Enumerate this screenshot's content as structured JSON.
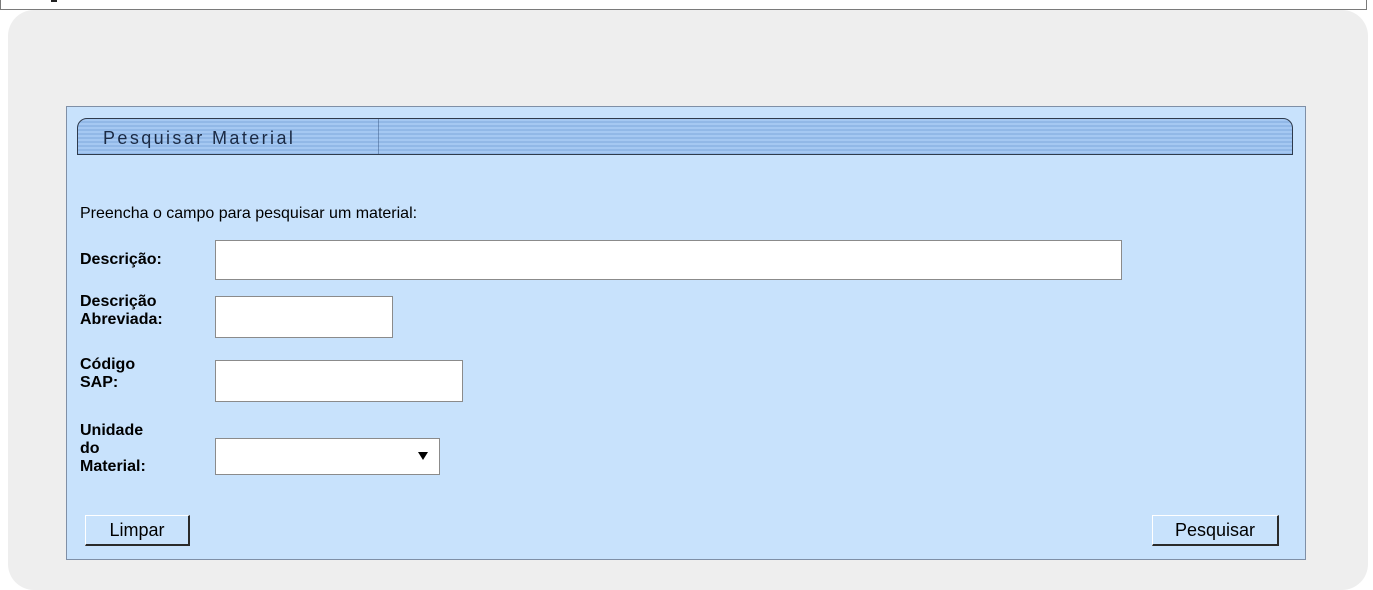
{
  "form": {
    "title": "Pesquisar Material",
    "instruction": "Preencha o campo para pesquisar um material:",
    "fields": {
      "descricao": {
        "label": "Descrição:",
        "value": ""
      },
      "descricao_abreviada": {
        "label_line1": "Descrição",
        "label_line2": "Abreviada:",
        "value": ""
      },
      "codigo_sap": {
        "label_line1": "Código",
        "label_line2": "SAP:",
        "value": ""
      },
      "unidade_material": {
        "label_line1": "Unidade",
        "label_line2": "do",
        "label_line3": "Material:",
        "selected": ""
      }
    },
    "buttons": {
      "clear_label": "Limpar",
      "search_label": "Pesquisar"
    }
  },
  "colors": {
    "panel_bg": "#eeeeee",
    "form_bg": "#c8e2fc",
    "title_bar": "#a5c8f2"
  }
}
